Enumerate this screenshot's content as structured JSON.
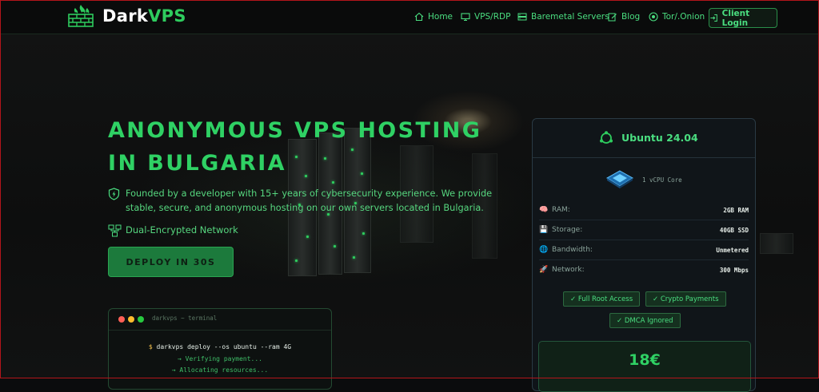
{
  "brand": {
    "name_main": "Dark",
    "name_accent": "VPS",
    "accent_color": "#2ecc5e"
  },
  "nav": {
    "items": [
      {
        "label": "Home",
        "icon": "home-icon"
      },
      {
        "label": "VPS/RDP",
        "icon": "monitor-icon"
      },
      {
        "label": "Baremetal Servers",
        "icon": "server-icon"
      },
      {
        "label": "Blog",
        "icon": "edit-icon"
      },
      {
        "label": "Tor/.Onion",
        "icon": "tor-icon"
      }
    ],
    "login_label": "Client Login"
  },
  "hero": {
    "title": "ANONYMOUS VPS HOSTING IN BULGARIA",
    "description": "Founded by a developer with 15+ years of cybersecurity experience. We provide stable, secure, and anonymous hosting on our own servers located in Bulgaria.",
    "feature": "Dual-Encrypted Network",
    "cta": "DEPLOY IN 30S"
  },
  "terminal": {
    "title": "darkvps ~ terminal",
    "prompt": "$",
    "command": "darkvps deploy --os ubuntu --ram 4G",
    "lines": [
      "→ Verifying payment...",
      "→ Allocating resources..."
    ]
  },
  "plan": {
    "os": "Ubuntu 24.04",
    "cpu": "1 vCPU Core",
    "specs": [
      {
        "label": "RAM:",
        "value": "2GB RAM",
        "icon": "brain-icon"
      },
      {
        "label": "Storage:",
        "value": "40GB SSD",
        "icon": "disk-icon"
      },
      {
        "label": "Bandwidth:",
        "value": "Unmetered",
        "icon": "globe-icon"
      },
      {
        "label": "Network:",
        "value": "300 Mbps",
        "icon": "rocket-icon"
      }
    ],
    "badges": [
      "✓ Full Root Access",
      "✓ Crypto Payments",
      "✓ DMCA Ignored"
    ],
    "price": "18€"
  }
}
